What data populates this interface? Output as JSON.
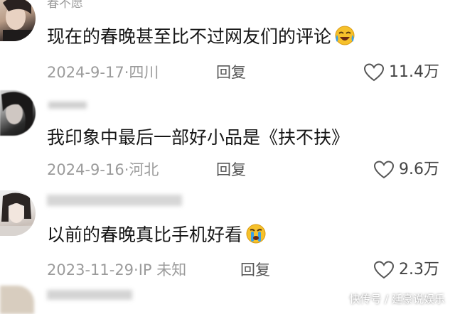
{
  "comments": [
    {
      "username": "春不愿",
      "content": "现在的春晚甚至比不过网友们的评论",
      "emoji": "laughing-crying-emoji",
      "date": "2024-9-17",
      "location": "四川",
      "reply_label": "回复",
      "likes": "11.4万"
    },
    {
      "username": "",
      "content": "我印象中最后一部好小品是《扶不扶》",
      "date": "2024-9-16",
      "location": "河北",
      "reply_label": "回复",
      "likes": "9.6万"
    },
    {
      "username": "",
      "content": "以前的春晚真比手机好看",
      "emoji": "crying-emoji",
      "date": "2023-11-29",
      "location": "IP 未知",
      "reply_label": "回复",
      "likes": "2.3万"
    }
  ],
  "separator": "·",
  "watermark": "快传号 / 廷豪说娱乐",
  "colors": {
    "text_primary": "#161616",
    "text_secondary": "#9b9b9b",
    "emoji_yellow": "#f6c12b",
    "emoji_tear": "#3aa0e8"
  }
}
